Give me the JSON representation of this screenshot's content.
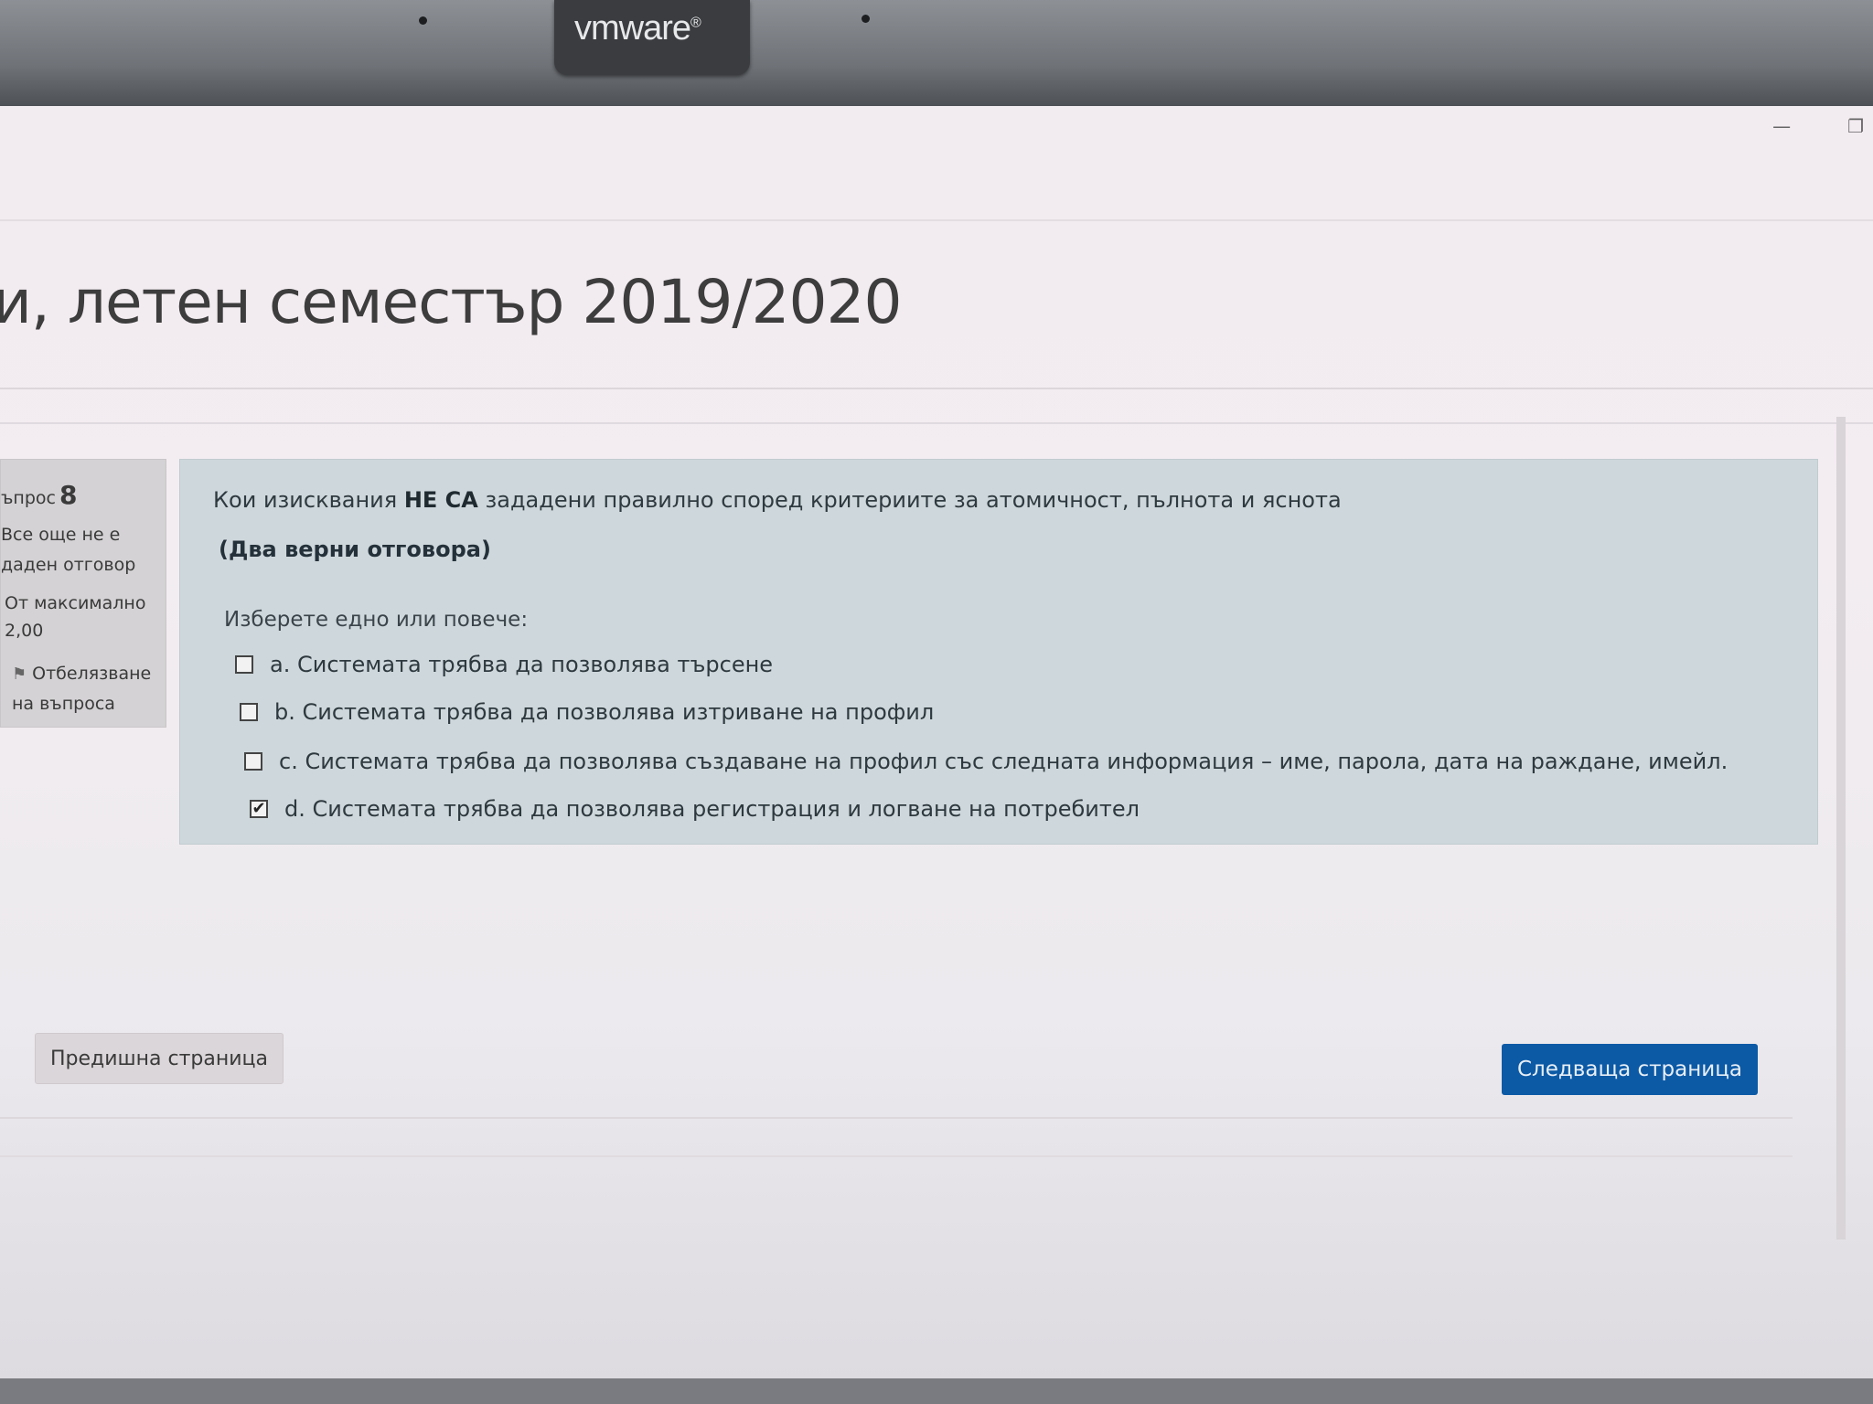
{
  "vmware": {
    "logo": "vmware",
    "registered": "®"
  },
  "window": {
    "minimize": "—",
    "restore": "❐"
  },
  "page": {
    "title": "и, летен семестър 2019/2020"
  },
  "question_info": {
    "label": "ъпрос",
    "number": "8",
    "state": "Все още не е даден отговор",
    "mark": "От максимално 2,00",
    "flag": "Отбелязване на въпроса"
  },
  "question": {
    "text_prefix": "Кои изисквания ",
    "text_bold": "НЕ СА",
    "text_suffix": " зададени правилно според критериите за атомичност, пълнота и яснота",
    "note": "(Два верни отговора)",
    "prompt": "Изберете едно или повече:",
    "answers": [
      {
        "label": "a. Системата трябва да позволява търсене",
        "checked": false
      },
      {
        "label": "b. Системата трябва да позволява изтриване на профил",
        "checked": false
      },
      {
        "label": "c. Системата трябва да позволява създаване на профил със следната информация – име, парола, дата на раждане, имейл.",
        "checked": false
      },
      {
        "label": "d. Системата трябва да позволява регистрация и логване на потребител",
        "checked": true
      }
    ]
  },
  "nav": {
    "prev": "Предишна страница",
    "next": "Следваща страница"
  },
  "colors": {
    "next_button": "#0c5aa6",
    "question_card": "#ced8dc"
  }
}
